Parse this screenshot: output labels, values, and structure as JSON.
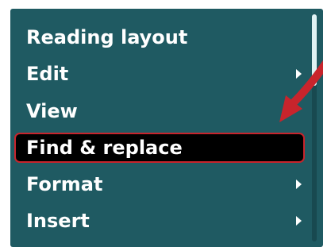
{
  "menu": {
    "items": [
      {
        "label": "Reading layout",
        "has_submenu": false,
        "selected": false
      },
      {
        "label": "Edit",
        "has_submenu": true,
        "selected": false
      },
      {
        "label": "View",
        "has_submenu": false,
        "selected": false
      },
      {
        "label": "Find & replace",
        "has_submenu": false,
        "selected": true
      },
      {
        "label": "Format",
        "has_submenu": true,
        "selected": false
      },
      {
        "label": "Insert",
        "has_submenu": true,
        "selected": false
      }
    ]
  },
  "colors": {
    "menu_background": "#1f5a62",
    "selected_background": "#000000",
    "selected_border": "#c8242c",
    "text": "#ffffff",
    "callout_arrow": "#c8242c"
  },
  "icons": {
    "submenu": "chevron-right-icon",
    "callout": "pointer-arrow-icon"
  }
}
